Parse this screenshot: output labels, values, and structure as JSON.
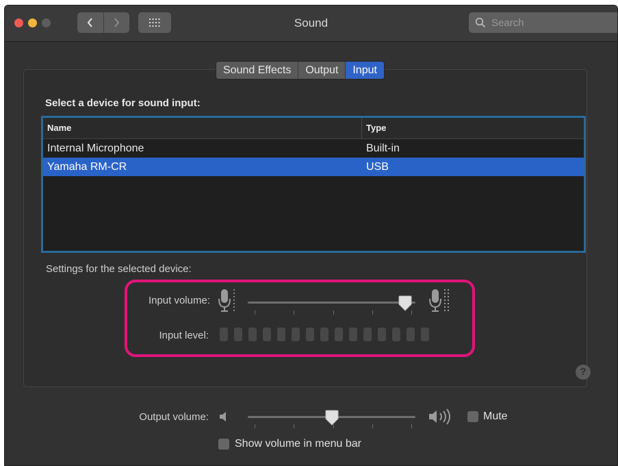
{
  "window": {
    "title": "Sound"
  },
  "search": {
    "placeholder": "Search"
  },
  "tabs": [
    {
      "label": "Sound Effects",
      "active": false
    },
    {
      "label": "Output",
      "active": false
    },
    {
      "label": "Input",
      "active": true
    }
  ],
  "device_list": {
    "heading": "Select a device for sound input:",
    "columns": {
      "name": "Name",
      "type": "Type"
    },
    "rows": [
      {
        "name": "Internal Microphone",
        "type": "Built-in",
        "selected": false
      },
      {
        "name": "Yamaha RM-CR",
        "type": "USB",
        "selected": true
      }
    ]
  },
  "settings": {
    "heading": "Settings for the selected device:",
    "input_volume_label": "Input volume:",
    "input_volume_level": 0.94,
    "input_level_label": "Input level:",
    "input_level_segments": 15,
    "input_level_active": 0
  },
  "output": {
    "volume_label": "Output volume:",
    "volume_level": 0.5,
    "mute_label": "Mute",
    "mute_checked": false,
    "show_in_menu_bar_label": "Show volume in menu bar",
    "show_in_menu_bar_checked": false
  },
  "colors": {
    "accent": "#2a63c8",
    "highlight_frame": "#e0147a",
    "window_bg": "#323232"
  },
  "icons": {
    "back": "chevron-left-icon",
    "forward": "chevron-right-icon",
    "grid": "grid-icon",
    "search": "search-icon",
    "mic": "microphone-icon",
    "speaker": "speaker-icon",
    "help": "help-icon"
  }
}
